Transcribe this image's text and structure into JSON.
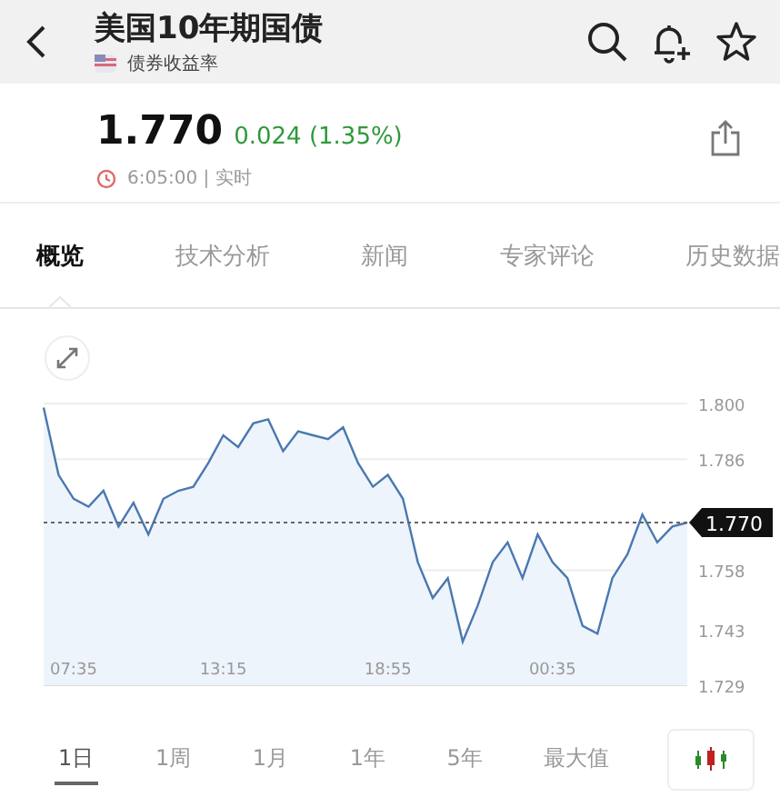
{
  "header": {
    "title": "美国10年期国债",
    "subtitle": "债券收益率"
  },
  "quote": {
    "price": "1.770",
    "change": "0.024 (1.35%)",
    "time": "6:05:00 | 实时"
  },
  "tabs": [
    {
      "label": "概览",
      "selected": true
    },
    {
      "label": "技术分析",
      "selected": false
    },
    {
      "label": "新闻",
      "selected": false
    },
    {
      "label": "专家评论",
      "selected": false
    },
    {
      "label": "历史数据",
      "selected": false
    }
  ],
  "chart": {
    "current_label": "1.770",
    "chart_data": {
      "type": "area",
      "grid": true,
      "categories": [
        null,
        null,
        "07:35",
        null,
        null,
        null,
        null,
        null,
        null,
        null,
        null,
        null,
        "13:15",
        null,
        null,
        null,
        null,
        null,
        null,
        null,
        null,
        null,
        null,
        "18:55",
        null,
        null,
        null,
        null,
        null,
        null,
        null,
        null,
        null,
        null,
        "00:35",
        null,
        null,
        null,
        null,
        null,
        null,
        null,
        null,
        null
      ],
      "series": [
        {
          "color": "#4a78b0",
          "values": [
            1.799,
            1.782,
            1.776,
            1.774,
            1.778,
            1.769,
            1.775,
            1.767,
            1.776,
            1.778,
            1.779,
            1.785,
            1.792,
            1.789,
            1.795,
            1.796,
            1.788,
            1.793,
            1.792,
            1.791,
            1.794,
            1.785,
            1.779,
            1.782,
            1.776,
            1.76,
            1.751,
            1.756,
            1.74,
            1.749,
            1.76,
            1.765,
            1.756,
            1.767,
            1.76,
            1.756,
            1.744,
            1.742,
            1.756,
            1.762,
            1.772,
            1.765,
            1.769,
            1.77
          ]
        }
      ],
      "ylim": [
        1.729,
        1.8
      ],
      "yticks": [
        {
          "value": 1.8,
          "label": "1.800"
        },
        {
          "value": 1.786,
          "label": "1.786"
        },
        {
          "value": 1.758,
          "label": "1.758"
        },
        {
          "value": 1.743,
          "label": "1.743"
        },
        {
          "value": 1.729,
          "label": "1.729"
        }
      ]
    }
  },
  "ranges": [
    {
      "label": "1日",
      "selected": true
    },
    {
      "label": "1周",
      "selected": false
    },
    {
      "label": "1月",
      "selected": false
    },
    {
      "label": "1年",
      "selected": false
    },
    {
      "label": "5年",
      "selected": false
    },
    {
      "label": "最大值",
      "selected": false
    }
  ]
}
